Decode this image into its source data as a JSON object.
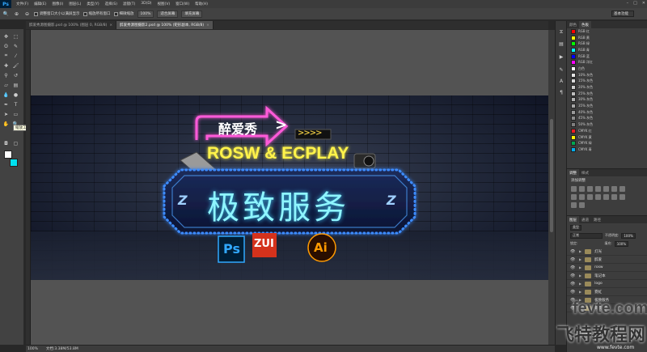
{
  "menubar": {
    "logo": "Ps",
    "menus": [
      "文件(F)",
      "编辑(E)",
      "图像(I)",
      "图层(L)",
      "类型(Y)",
      "选择(S)",
      "滤镜(T)",
      "3D(D)",
      "视图(V)",
      "窗口(W)",
      "帮助(H)"
    ],
    "min": "–",
    "max": "□",
    "close": "✕"
  },
  "options": {
    "resize": "调整窗口大小以满屏显示",
    "zoom_all": "缩放所有窗口",
    "scrubby": "细微缩放",
    "b100": "100%",
    "fit": "适合屏幕",
    "fill": "填充屏幕",
    "workspace": "基本功能"
  },
  "tabs": [
    {
      "label": "醉爱秀源图摄影.psd @ 100% (图层 0, RGB/8)",
      "close": "×",
      "active": false
    },
    {
      "label": "醉爱秀源图摄影2.psd @ 100% (矩形副本, RGB/8)",
      "close": "×",
      "active": true
    }
  ],
  "tooltip": "缩放工具 (Z)",
  "colors": {
    "foreground": "#ffffff",
    "background": "#00e1f0"
  },
  "banner": {
    "tagline": "醉爱秀",
    "chevron": ">",
    "arrows": ">>>>",
    "brand": "ROSW & ECPLAY",
    "headline": "极致服务",
    "z_left": "Z",
    "z_right": "Z",
    "ps": "Ps",
    "zui": "ZUI",
    "ai": "Ai"
  },
  "status": {
    "zoom": "100%",
    "doc": "文档:3.38M/53.8M"
  },
  "swatches": {
    "tabs": [
      "颜色",
      "色板"
    ],
    "items": [
      {
        "label": "RGB 红",
        "color": "#ff0000"
      },
      {
        "label": "RGB 黄",
        "color": "#ffff00"
      },
      {
        "label": "RGB 绿",
        "color": "#00ff00"
      },
      {
        "label": "RGB 青",
        "color": "#00ffff"
      },
      {
        "label": "RGB 蓝",
        "color": "#0000ff"
      },
      {
        "label": "RGB 洋红",
        "color": "#ff00ff"
      },
      {
        "label": "白色",
        "color": "#ffffff"
      },
      {
        "label": "10% 灰色",
        "color": "#e6e6e6"
      },
      {
        "label": "15% 灰色",
        "color": "#d9d9d9"
      },
      {
        "label": "20% 灰色",
        "color": "#cccccc"
      },
      {
        "label": "25% 灰色",
        "color": "#bfbfbf"
      },
      {
        "label": "30% 灰色",
        "color": "#b3b3b3"
      },
      {
        "label": "35% 灰色",
        "color": "#a6a6a6"
      },
      {
        "label": "40% 灰色",
        "color": "#999999"
      },
      {
        "label": "45% 灰色",
        "color": "#8c8c8c"
      },
      {
        "label": "50% 灰色",
        "color": "#808080"
      },
      {
        "label": "CMYK 红",
        "color": "#ed1c24"
      },
      {
        "label": "CMYK 黄",
        "color": "#fff200"
      },
      {
        "label": "CMYK 绿",
        "color": "#00a651"
      },
      {
        "label": "CMYK 青",
        "color": "#00aeef"
      }
    ]
  },
  "adjust": {
    "tabs": [
      "调整",
      "样式"
    ],
    "add": "添加调整"
  },
  "layers": {
    "tabs": [
      "图层",
      "通道",
      "路径"
    ],
    "kind": "类型",
    "mode": "正常",
    "opacity_label": "不透明度:",
    "opacity": "100%",
    "lock": "锁定:",
    "fill_label": "填充:",
    "fill": "100%",
    "items": [
      "灯光",
      "醉爱",
      "rosw",
      "笔记本",
      "logo",
      "霓虹",
      "极致服务",
      "背景"
    ]
  },
  "watermark": {
    "site": "fevte.com",
    "name": "飞特教程网",
    "url": "www.fevte.com"
  }
}
